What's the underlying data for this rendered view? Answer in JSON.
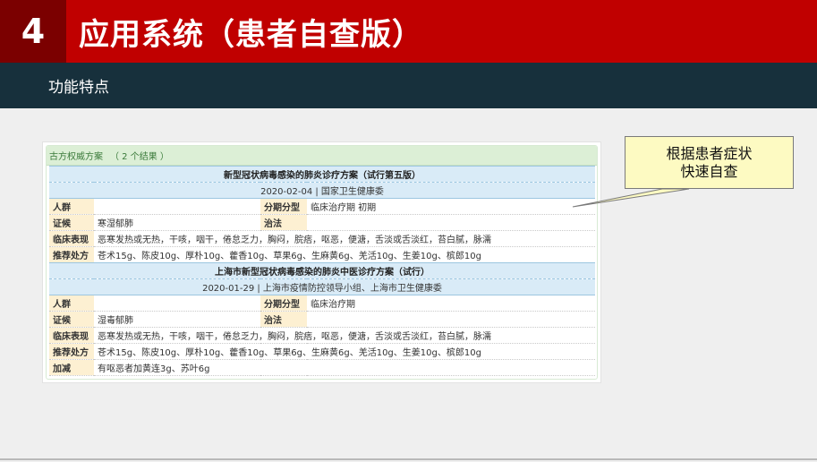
{
  "header": {
    "number": "4",
    "title": "应用系统（患者自查版）"
  },
  "subbar": {
    "title": "功能特点"
  },
  "panel": {
    "heading": "古方权威方案",
    "count": "（ 2 个结果 ）",
    "plans": [
      {
        "title": "新型冠状病毒感染的肺炎诊疗方案（试行第五版）",
        "source": "2020-02-04 | 国家卫生健康委",
        "rows": [
          {
            "label": "人群",
            "value": "",
            "label2": "分期分型",
            "value2": "临床治疗期 初期"
          },
          {
            "label": "证候",
            "value": "寒湿郁肺",
            "label2": "治法",
            "value2": ""
          },
          {
            "label": "临床表现",
            "value": "恶寒发热或无热，干咳，咽干，倦怠乏力，胸闷，脘痞，呕恶，便溏，舌淡或舌淡红，苔白腻，脉濡"
          },
          {
            "label": "推荐处方",
            "value": "苍术15g、陈皮10g、厚朴10g、藿香10g、草果6g、生麻黄6g、羌活10g、生姜10g、槟郎10g"
          }
        ]
      },
      {
        "title": "上海市新型冠状病毒感染的肺炎中医诊疗方案（试行）",
        "source": "2020-01-29 | 上海市疫情防控领导小组、上海市卫生健康委",
        "rows": [
          {
            "label": "人群",
            "value": "",
            "label2": "分期分型",
            "value2": "临床治疗期"
          },
          {
            "label": "证候",
            "value": "湿毒郁肺",
            "label2": "治法",
            "value2": ""
          },
          {
            "label": "临床表现",
            "value": "恶寒发热或无热，干咳，咽干，倦怠乏力，胸闷，脘痞，呕恶，便溏，舌淡或舌淡红，苔白腻，脉濡"
          },
          {
            "label": "推荐处方",
            "value": "苍术15g、陈皮10g、厚朴10g、藿香10g、草果6g、生麻黄6g、羌活10g、生姜10g、槟郎10g"
          },
          {
            "label": "加减",
            "value": "有呕恶者加黄连3g、苏叶6g"
          }
        ]
      }
    ]
  },
  "callout": {
    "line1": "根据患者症状",
    "line2": "快速自查"
  },
  "colors": {
    "header_red": "#c00000",
    "header_dark_red": "#7b0000",
    "subbar": "#17303c",
    "callout_bg": "#fdfac2"
  }
}
